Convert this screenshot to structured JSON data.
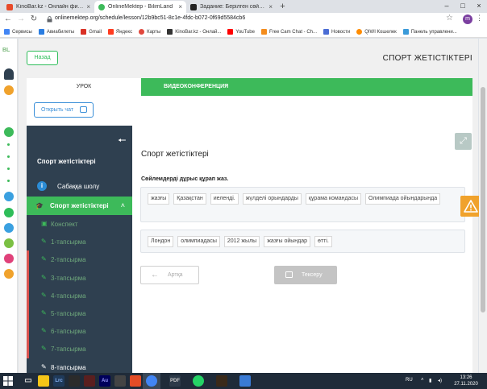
{
  "browser": {
    "tabs": [
      {
        "label": "KinoBar.kz - Онлайн фильмы и се",
        "color": "#e84a2a",
        "active": false
      },
      {
        "label": "OnlineMektep - BilimLand",
        "color": "#3dba5a",
        "active": true
      },
      {
        "label": "Задание: Берілген сөйлемдерд",
        "color": "#222",
        "active": false
      }
    ],
    "url": "onlinemektep.org/schedule/lesson/12b9bc51-8c1e-4fdc-b072-0f69d5584cb6",
    "profile_initial": "m",
    "bookmarks": [
      {
        "label": "Сервисы",
        "color": "#4285f4"
      },
      {
        "label": "Авиабилеты",
        "color": "#2a7de1"
      },
      {
        "label": "Gmail",
        "color": "#d93025"
      },
      {
        "label": "Яндекс",
        "color": "#ff3b1f"
      },
      {
        "label": "Карты",
        "color": "#e1483d"
      },
      {
        "label": "KinoBar.kz - Онлай...",
        "color": "#333333"
      },
      {
        "label": "YouTube",
        "color": "#ff0000"
      },
      {
        "label": "Free Cam Chat - Ch...",
        "color": "#f48c1c"
      },
      {
        "label": "Новости",
        "color": "#4a6cd4"
      },
      {
        "label": "QIWI Кошелек",
        "color": "#ff8c00"
      },
      {
        "label": "Панель управлени...",
        "color": "#3a9ad9"
      }
    ]
  },
  "left_strip": {
    "brand": "BL"
  },
  "page": {
    "back_label": "Назад",
    "title": "СПОРТ ЖЕТІСТІКТЕРІ",
    "tab_lesson": "УРОК",
    "tab_video": "ВИДЕОКОНФЕРЕНЦИЯ",
    "open_chat": "Открыть чат"
  },
  "sidebar": {
    "title": "Спорт жетістіктері",
    "overview": "Сабаққа шолу",
    "group": "Спорт жетістіктері",
    "items": [
      {
        "label": "Конспект",
        "marked": false,
        "current": false
      },
      {
        "label": "1-тапсырма",
        "marked": false,
        "current": false
      },
      {
        "label": "2-тапсырма",
        "marked": true,
        "current": false
      },
      {
        "label": "3-тапсырма",
        "marked": true,
        "current": false
      },
      {
        "label": "4-тапсырма",
        "marked": true,
        "current": false
      },
      {
        "label": "5-тапсырма",
        "marked": true,
        "current": false
      },
      {
        "label": "6-тапсырма",
        "marked": true,
        "current": false
      },
      {
        "label": "7-тапсырма",
        "marked": true,
        "current": false
      },
      {
        "label": "8-тапсырма",
        "marked": false,
        "current": true
      }
    ]
  },
  "content": {
    "title": "Спорт жетістіктері",
    "instruction": "Сөйлемдерді дұрыс құрап жаз.",
    "words_pool": [
      "жазғы",
      "Қазақстан",
      "иеленді.",
      "жүлделі орындарды",
      "құрама командасы",
      "Олимпиада ойындарында"
    ],
    "answer_words": [
      "Лондон",
      "олимпиадасы",
      "2012 жылы",
      "жазғы ойындар",
      "өтті."
    ],
    "btn_back": "Артқа",
    "btn_check": "Тексеру"
  },
  "taskbar": {
    "lang": "RU",
    "time": "13:26",
    "date": "27.11.2020"
  }
}
